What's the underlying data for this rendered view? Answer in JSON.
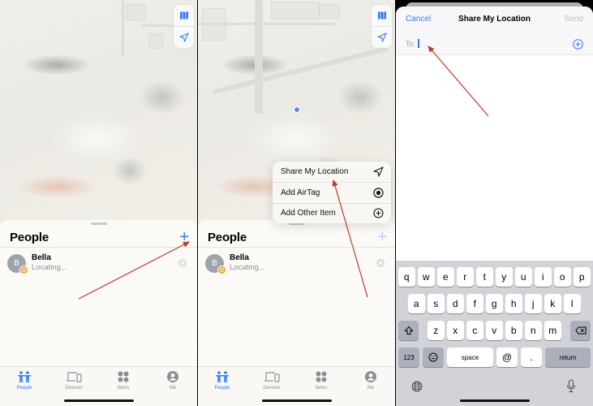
{
  "colors": {
    "accent": "#2f7cf6",
    "annotation_arrow": "#c0392b",
    "badge": "#f0a23a"
  },
  "panels": [
    {
      "map_controls": [
        {
          "icon": "map-icon"
        },
        {
          "icon": "location-arrow-icon"
        }
      ],
      "sheet": {
        "title": "People",
        "add_button": "+",
        "people": [
          {
            "initial": "B",
            "name": "Bella",
            "status": "Locating..."
          }
        ]
      },
      "tabs": [
        {
          "label": "People",
          "icon": "people-icon",
          "active": true
        },
        {
          "label": "Devices",
          "icon": "devices-icon",
          "active": false
        },
        {
          "label": "Items",
          "icon": "items-icon",
          "active": false
        },
        {
          "label": "Me",
          "icon": "person-circle-icon",
          "active": false
        }
      ]
    },
    {
      "map_controls": [
        {
          "icon": "map-icon"
        },
        {
          "icon": "location-arrow-icon"
        }
      ],
      "menu": [
        {
          "label": "Share My Location",
          "icon": "location-arrow-icon"
        },
        {
          "label": "Add AirTag",
          "icon": "airtag-icon"
        },
        {
          "label": "Add Other Item",
          "icon": "plus-circle-icon"
        }
      ],
      "sheet": {
        "title": "People",
        "add_button": "+",
        "people": [
          {
            "initial": "B",
            "name": "Bella",
            "status": "Locating..."
          }
        ]
      },
      "tabs": [
        {
          "label": "People",
          "icon": "people-icon",
          "active": true
        },
        {
          "label": "Devices",
          "icon": "devices-icon",
          "active": false
        },
        {
          "label": "Items",
          "icon": "items-icon",
          "active": false
        },
        {
          "label": "Me",
          "icon": "person-circle-icon",
          "active": false
        }
      ]
    },
    {
      "compose": {
        "cancel": "Cancel",
        "title": "Share My Location",
        "send": "Send",
        "to_label": "To:",
        "to_value": ""
      },
      "keyboard": {
        "row1": [
          "q",
          "w",
          "e",
          "r",
          "t",
          "y",
          "u",
          "i",
          "o",
          "p"
        ],
        "row2": [
          "a",
          "s",
          "d",
          "f",
          "g",
          "h",
          "j",
          "k",
          "l"
        ],
        "row3": [
          "z",
          "x",
          "c",
          "v",
          "b",
          "n",
          "m"
        ],
        "numbers": "123",
        "space": "space",
        "at": "@",
        "dot": ".",
        "return": "return"
      }
    }
  ]
}
